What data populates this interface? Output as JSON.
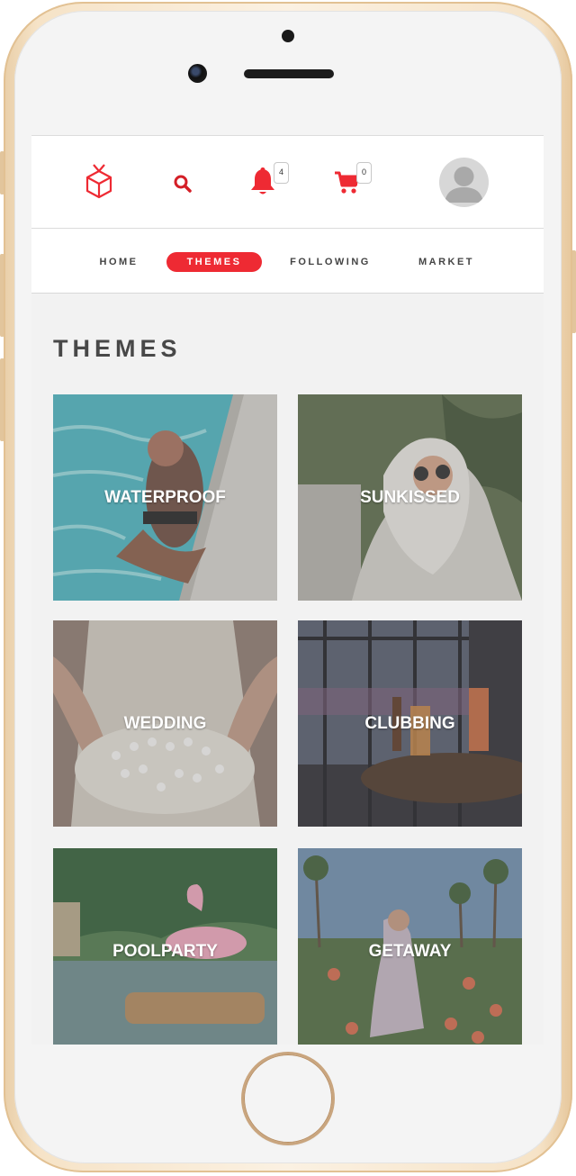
{
  "app": {
    "notifications_count": "4",
    "cart_count": "0",
    "accent_color": "#ee2a33"
  },
  "header": {
    "icons": [
      "logo-cube-icon",
      "search-icon",
      "bell-icon",
      "cart-icon",
      "user-avatar"
    ]
  },
  "tabs": [
    {
      "label": "HOME",
      "active": false
    },
    {
      "label": "THEMES",
      "active": true
    },
    {
      "label": "FOLLOWING",
      "active": false
    },
    {
      "label": "MARKET",
      "active": false
    }
  ],
  "main": {
    "title": "THEMES",
    "themes": [
      {
        "label": "WATERPROOF"
      },
      {
        "label": "SUNKISSED"
      },
      {
        "label": "WEDDING"
      },
      {
        "label": "CLUBBING"
      },
      {
        "label": "POOLPARTY"
      },
      {
        "label": "GETAWAY"
      }
    ]
  }
}
